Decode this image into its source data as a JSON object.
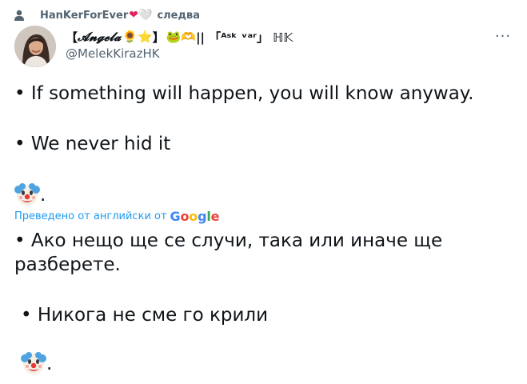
{
  "context": {
    "retweeter_name": "HanKerForEver",
    "hearts": [
      "❤",
      "🤍"
    ],
    "follows_label": "следва"
  },
  "author": {
    "display_name_prefix": "【",
    "display_name_script": "𝓐𝓷𝓰𝓮𝓵𝓪",
    "display_name_emojis": "🌻⭐",
    "display_name_suffix_a": "】",
    "display_name_extra": "🐸🫶",
    "display_name_tail": "|| 「ᴬˢᵏ ᵛᵃʳ」 ℍ𝕂",
    "handle": "@MelekKirazHK",
    "more_icon": "···"
  },
  "tweet": {
    "line1": "• If something will happen, you will know anyway.",
    "line2": "• We never hid it",
    "clown_suffix": "."
  },
  "translation": {
    "label": "Преведено от английски от",
    "provider": "Google",
    "line1": "• Ако нещо ще се случи, така или иначе ще",
    "line2": "разберете.",
    "line3": "• Никога не сме го крили",
    "clown_suffix": " ."
  },
  "colors": {
    "link_blue": "#1d9bf0",
    "secondary_text": "#536471"
  }
}
